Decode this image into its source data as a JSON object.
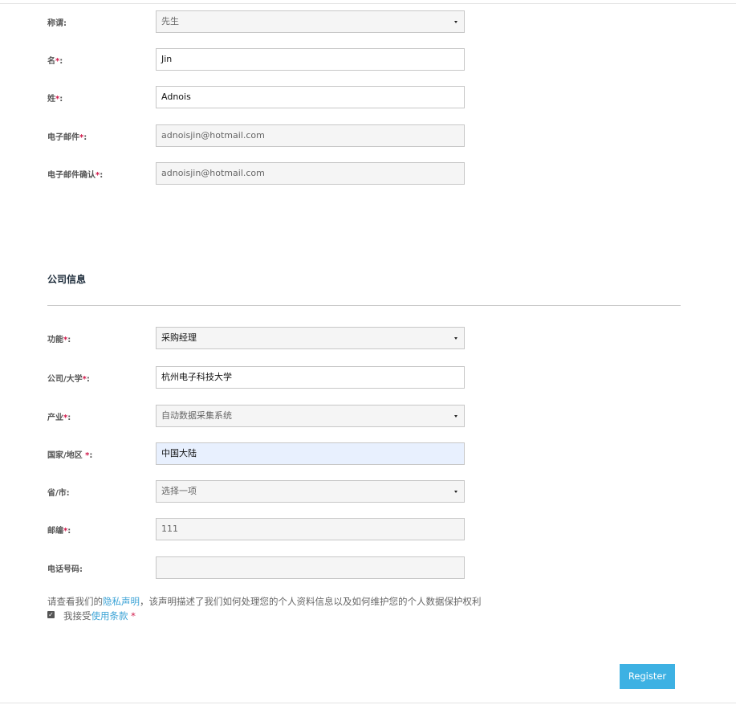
{
  "personal": {
    "salutation": {
      "label": "称谓:",
      "value": "先生"
    },
    "first_name": {
      "label": "名",
      "req": "*",
      "colon": ":",
      "value": "Jin"
    },
    "last_name": {
      "label": "姓",
      "req": "*",
      "colon": ":",
      "value": "Adnois"
    },
    "email": {
      "label": "电子邮件",
      "req": "*",
      "colon": ":",
      "value": "adnoisjin@hotmail.com"
    },
    "email_confirm": {
      "label": "电子邮件确认",
      "req": "*",
      "colon": ":",
      "value": "adnoisjin@hotmail.com"
    }
  },
  "company": {
    "section_title": "公司信息",
    "function": {
      "label": "功能",
      "req": "*",
      "colon": ":",
      "value": "采购经理"
    },
    "company_name": {
      "label": "公司/大学",
      "req": "*",
      "colon": ":",
      "value": "杭州电子科技大学"
    },
    "industry": {
      "label": "产业",
      "req": "*",
      "colon": ":",
      "value": "自动数据采集系统"
    },
    "country": {
      "label": "国家/地区 ",
      "req": "*",
      "colon": ":",
      "value": "中国大陆"
    },
    "province": {
      "label": "省/市:",
      "value": "选择一项"
    },
    "postcode": {
      "label": "邮编",
      "req": "*",
      "colon": ":",
      "value": "111"
    },
    "phone": {
      "label": "电话号码:",
      "value": ""
    }
  },
  "privacy": {
    "prefix": "请查看我们的",
    "link": "隐私声明",
    "suffix": "，该声明描述了我们如何处理您的个人资料信息以及如何维护您的个人数据保护权利"
  },
  "terms": {
    "checked": true,
    "prefix": "我接受",
    "link": "使用条款",
    "req": " *"
  },
  "register_label": "Register",
  "colors": {
    "accent": "#3db1e3",
    "link": "#3ba3d6",
    "required": "#d0184a"
  },
  "icons": {
    "select_caret": "caret-down-icon",
    "checkbox": "checkbox-checked-icon"
  }
}
